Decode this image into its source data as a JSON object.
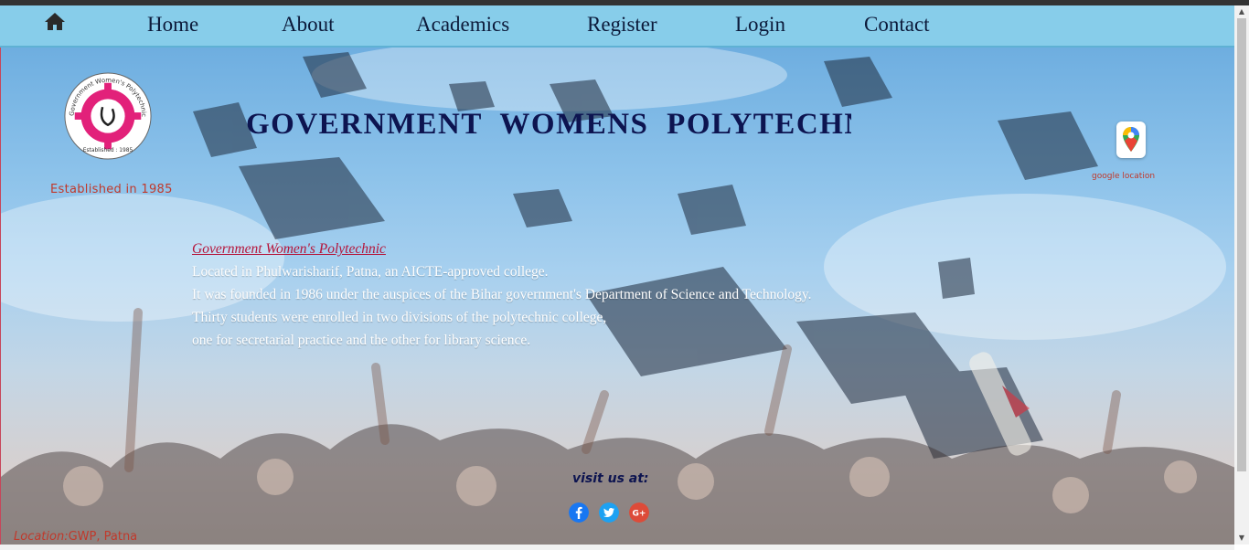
{
  "nav": {
    "home_icon": "home-icon",
    "items": [
      {
        "label": "Home"
      },
      {
        "label": "About"
      },
      {
        "label": "Academics"
      },
      {
        "label": "Register"
      },
      {
        "label": "Login"
      },
      {
        "label": "Contact"
      }
    ]
  },
  "header": {
    "title": "GOVERNMENT  WOMENS  POLYTECHNIC",
    "logo": {
      "arc_text": "Government Women's Polytechnic Patna",
      "established_text": "Established : 1985"
    },
    "established": "Established in 1985",
    "map_icon": "google-maps-pin-icon",
    "map_label": "google location"
  },
  "about": {
    "heading": "Government Women's Polytechnic",
    "lines": [
      "Located in Phulwarisharif, Patna, an AICTE-approved college.",
      "It was founded in 1986 under the auspices of the Bihar government's Department of Science and Technology.",
      "Thirty students were enrolled in two divisions of the polytechnic college,",
      "one for secretarial practice and the other for library science."
    ]
  },
  "footer": {
    "visit_label": "visit us at:",
    "social": [
      {
        "name": "facebook-icon",
        "color": "#1877f2"
      },
      {
        "name": "twitter-icon",
        "color": "#1da1f2"
      },
      {
        "name": "google-plus-icon",
        "color": "#dd4b39",
        "text": "G+"
      }
    ],
    "location_label": "Location:",
    "location_value": "GWP, Patna"
  },
  "colors": {
    "nav_bg": "#87cdea",
    "title": "#0d1450",
    "accent_red": "#c0392b"
  }
}
